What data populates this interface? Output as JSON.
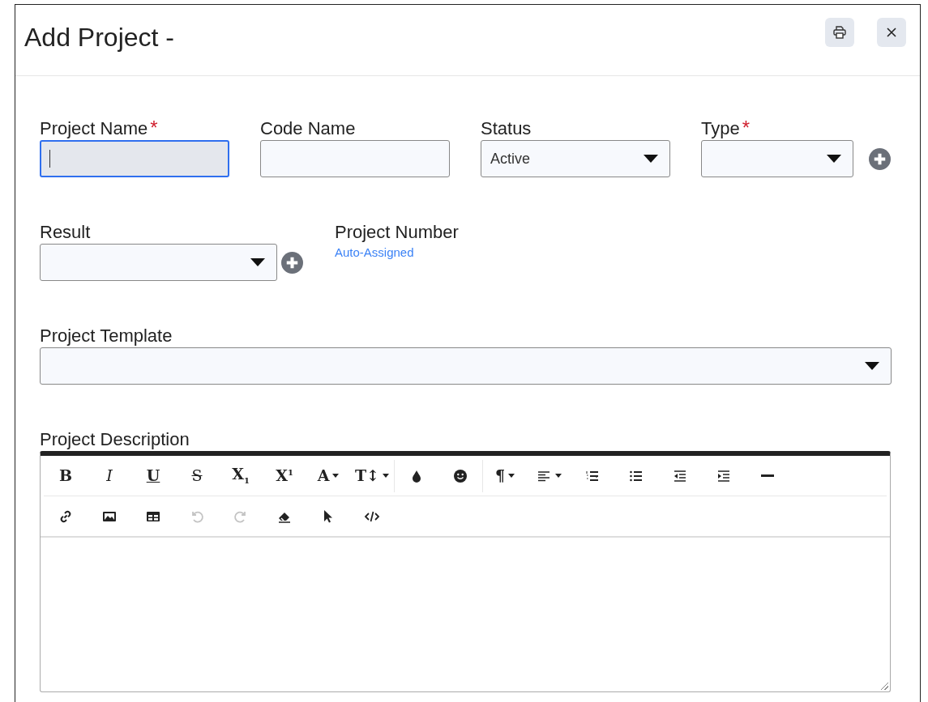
{
  "dialog": {
    "title": "Add Project -",
    "buttons": [
      {
        "kind": "print"
      },
      {
        "kind": "close"
      }
    ]
  },
  "form": {
    "rows": [
      {
        "fields": [
          {
            "label": "Project Name",
            "required_mark": "*",
            "kind": "text",
            "focused": true
          },
          {
            "label": "Code Name",
            "kind": "text"
          },
          {
            "label": "Status",
            "kind": "select",
            "value": "Active"
          },
          {
            "label": "Type",
            "required_mark": "*",
            "kind": "select",
            "add_button": true
          }
        ]
      },
      {
        "fields": [
          {
            "label": "Result",
            "kind": "select",
            "add_button": true
          },
          {
            "label": "Project Number",
            "kind": "info",
            "value": "Auto-Assigned"
          }
        ]
      },
      {
        "fields": [
          {
            "label": "Project Template",
            "kind": "select"
          }
        ]
      }
    ]
  },
  "description": {
    "label": "Project Description",
    "toolbar": [
      {
        "groups": [
          {
            "buttons": [
              {
                "kind": "bold",
                "text": "B"
              },
              {
                "kind": "italic",
                "text": "I"
              },
              {
                "kind": "underline",
                "text": "U"
              },
              {
                "kind": "strike",
                "text": "S"
              },
              {
                "kind": "sub",
                "text": "X$_{1}$"
              },
              {
                "kind": "sup",
                "text": "X$^{1}$"
              },
              {
                "kind": "font",
                "text": "A",
                "menu": true
              },
              {
                "kind": "size",
                "text": "T↕",
                "menu": true
              }
            ]
          },
          {
            "buttons": [
              {
                "kind": "drop"
              },
              {
                "kind": "smile"
              }
            ]
          },
          {
            "buttons": [
              {
                "kind": "para",
                "text": "¶",
                "menu": true
              },
              {
                "kind": "align",
                "menu": true
              },
              {
                "kind": "ol"
              },
              {
                "kind": "ul"
              },
              {
                "kind": "outdent"
              },
              {
                "kind": "indent"
              },
              {
                "kind": "hr"
              }
            ]
          }
        ]
      },
      {
        "groups": [
          {
            "buttons": [
              {
                "kind": "link"
              },
              {
                "kind": "image"
              },
              {
                "kind": "table"
              },
              {
                "kind": "undo",
                "disabled": true
              },
              {
                "kind": "redo",
                "disabled": true
              },
              {
                "kind": "eraser"
              },
              {
                "kind": "pointer"
              },
              {
                "kind": "code"
              }
            ]
          }
        ]
      }
    ]
  }
}
